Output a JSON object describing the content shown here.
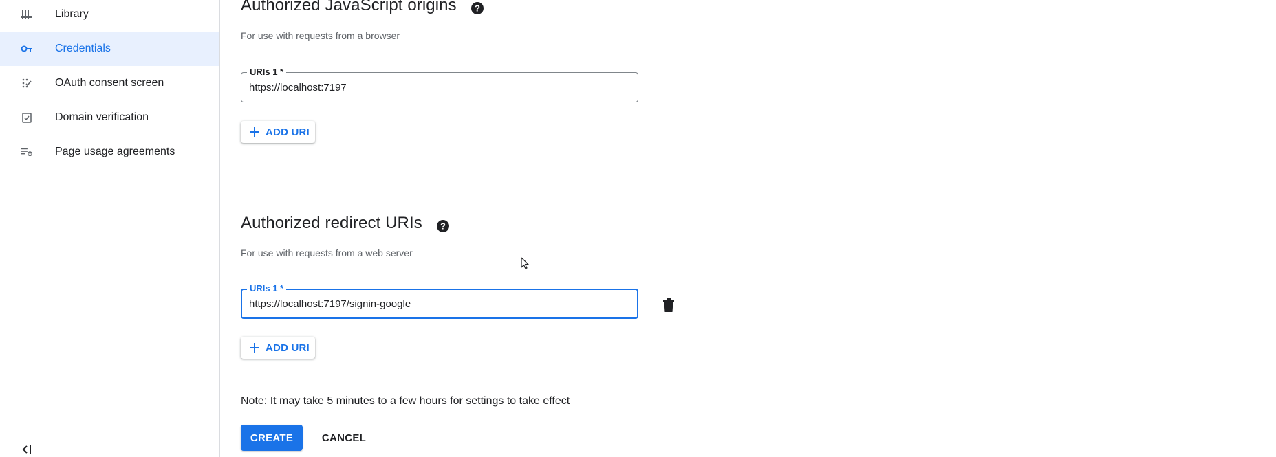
{
  "sidebar": {
    "items": [
      {
        "label": "Library",
        "icon": "library-icon",
        "active": false
      },
      {
        "label": "Credentials",
        "icon": "key-icon",
        "active": true
      },
      {
        "label": "OAuth consent screen",
        "icon": "consent-icon",
        "active": false
      },
      {
        "label": "Domain verification",
        "icon": "domain-check-icon",
        "active": false
      },
      {
        "label": "Page usage agreements",
        "icon": "list-settings-icon",
        "active": false
      }
    ],
    "collapse_icon": "collapse-sidebar-icon"
  },
  "js_origins": {
    "title": "Authorized JavaScript origins",
    "subtitle": "For use with requests from a browser",
    "field_label": "URIs 1 *",
    "field_value": "https://localhost:7197",
    "add_label": "ADD URI"
  },
  "redirect_uris": {
    "title": "Authorized redirect URIs",
    "subtitle": "For use with requests from a web server",
    "field_label": "URIs 1 *",
    "field_value": "https://localhost:7197/signin-google",
    "add_label": "ADD URI"
  },
  "note": "Note: It may take 5 minutes to a few hours for settings to take effect",
  "actions": {
    "create_label": "CREATE",
    "cancel_label": "CANCEL"
  },
  "colors": {
    "accent": "#1a73e8",
    "active_bg": "#e8f0fe",
    "text": "#202124",
    "muted": "#5f6368"
  }
}
